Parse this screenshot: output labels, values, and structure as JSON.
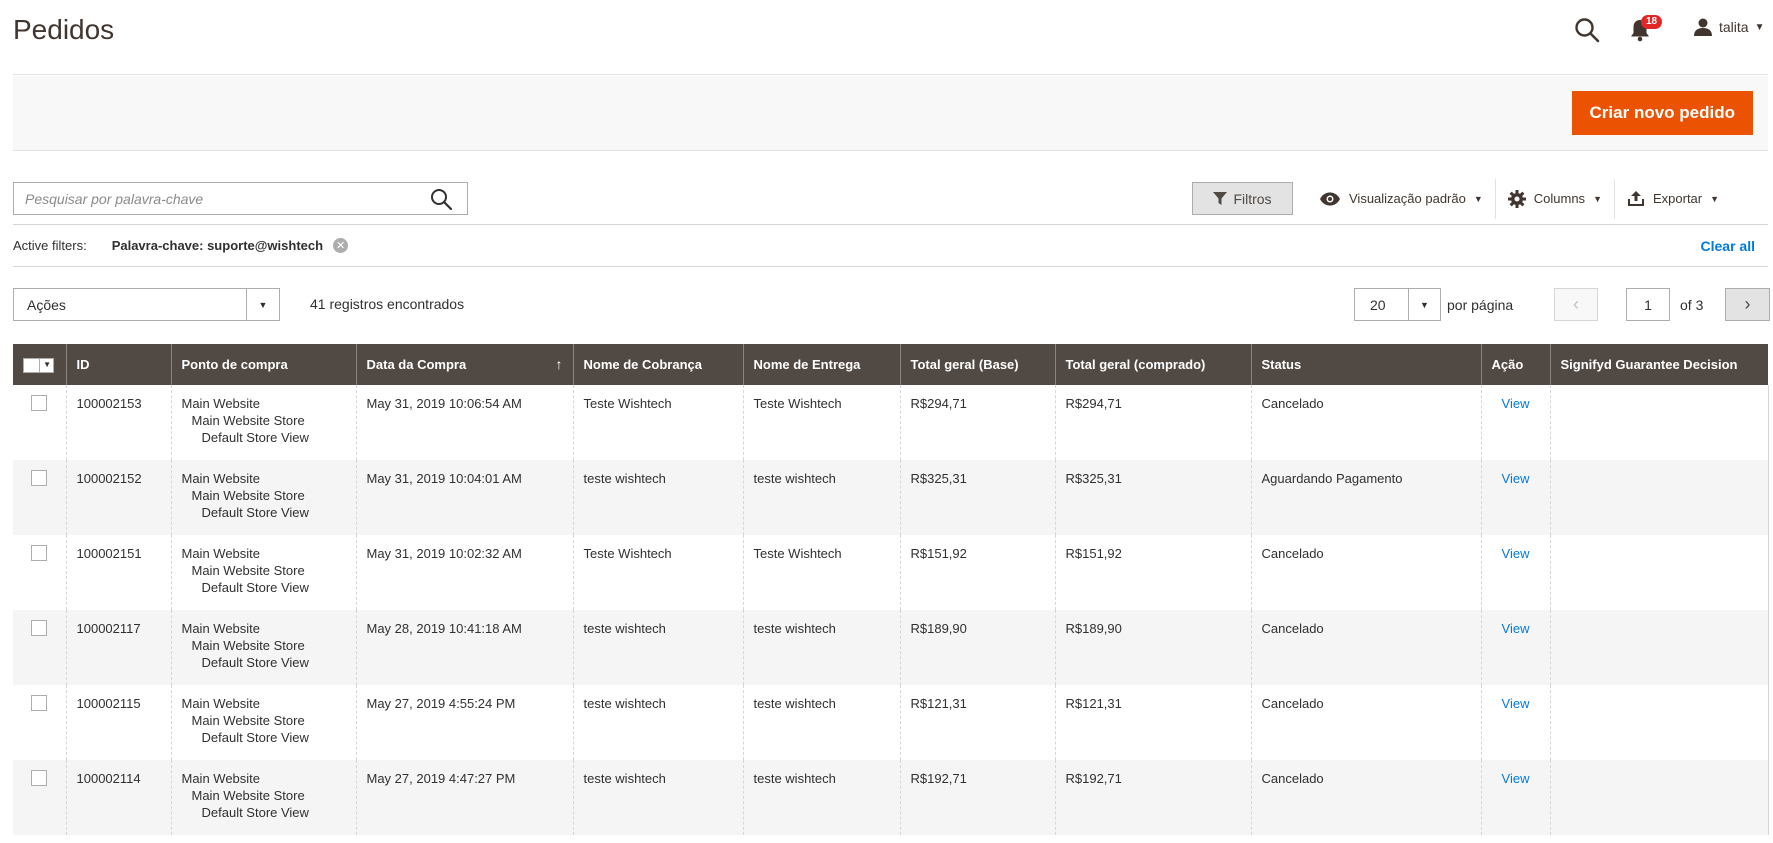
{
  "header": {
    "title": "Pedidos",
    "notifications_count": "18",
    "user_name": "talita"
  },
  "actions": {
    "create_label": "Criar novo pedido"
  },
  "search": {
    "placeholder": "Pesquisar por palavra-chave",
    "value": ""
  },
  "toolbar": {
    "filters_label": "Filtros",
    "view_label": "Visualização padrão",
    "columns_label": "Columns",
    "export_label": "Exportar"
  },
  "active_filters": {
    "label": "Active filters:",
    "value": "Palavra-chave: suporte@wishtech",
    "clear_label": "Clear all"
  },
  "mass_actions": {
    "label": "Ações"
  },
  "records_text": "41 registros encontrados",
  "pagination": {
    "per_page_value": "20",
    "per_page_label": "por página",
    "current_page": "1",
    "of_label": "of 3"
  },
  "table": {
    "columns": [
      "ID",
      "Ponto de compra",
      "Data da Compra",
      "Nome de Cobrança",
      "Nome de Entrega",
      "Total geral (Base)",
      "Total geral (comprado)",
      "Status",
      "Ação",
      "Signifyd Guarantee Decision"
    ],
    "rows": [
      {
        "id": "100002153",
        "store": [
          "Main Website",
          "Main Website Store",
          "Default Store View"
        ],
        "date": "May 31, 2019 10:06:54 AM",
        "billing": "Teste Wishtech",
        "shipping": "Teste Wishtech",
        "total_base": "R$294,71",
        "total_purchased": "R$294,71",
        "status": "Cancelado",
        "action": "View",
        "signifyd": ""
      },
      {
        "id": "100002152",
        "store": [
          "Main Website",
          "Main Website Store",
          "Default Store View"
        ],
        "date": "May 31, 2019 10:04:01 AM",
        "billing": "teste wishtech",
        "shipping": "teste wishtech",
        "total_base": "R$325,31",
        "total_purchased": "R$325,31",
        "status": "Aguardando Pagamento",
        "action": "View",
        "signifyd": ""
      },
      {
        "id": "100002151",
        "store": [
          "Main Website",
          "Main Website Store",
          "Default Store View"
        ],
        "date": "May 31, 2019 10:02:32 AM",
        "billing": "Teste Wishtech",
        "shipping": "Teste Wishtech",
        "total_base": "R$151,92",
        "total_purchased": "R$151,92",
        "status": "Cancelado",
        "action": "View",
        "signifyd": ""
      },
      {
        "id": "100002117",
        "store": [
          "Main Website",
          "Main Website Store",
          "Default Store View"
        ],
        "date": "May 28, 2019 10:41:18 AM",
        "billing": "teste wishtech",
        "shipping": "teste wishtech",
        "total_base": "R$189,90",
        "total_purchased": "R$189,90",
        "status": "Cancelado",
        "action": "View",
        "signifyd": ""
      },
      {
        "id": "100002115",
        "store": [
          "Main Website",
          "Main Website Store",
          "Default Store View"
        ],
        "date": "May 27, 2019 4:55:24 PM",
        "billing": "teste wishtech",
        "shipping": "teste wishtech",
        "total_base": "R$121,31",
        "total_purchased": "R$121,31",
        "status": "Cancelado",
        "action": "View",
        "signifyd": ""
      },
      {
        "id": "100002114",
        "store": [
          "Main Website",
          "Main Website Store",
          "Default Store View"
        ],
        "date": "May 27, 2019 4:47:27 PM",
        "billing": "teste wishtech",
        "shipping": "teste wishtech",
        "total_base": "R$192,71",
        "total_purchased": "R$192,71",
        "status": "Cancelado",
        "action": "View",
        "signifyd": ""
      }
    ]
  },
  "colors": {
    "primary_button": "#eb5202",
    "table_header": "#514943",
    "link": "#007bdb",
    "badge": "#e22626"
  },
  "icons": {
    "search": "search-icon",
    "notifications": "bell-icon",
    "user": "user-icon",
    "filter": "funnel-icon",
    "view": "eye-icon",
    "columns": "gear-icon",
    "export": "export-icon",
    "remove_filter": "close-icon"
  }
}
